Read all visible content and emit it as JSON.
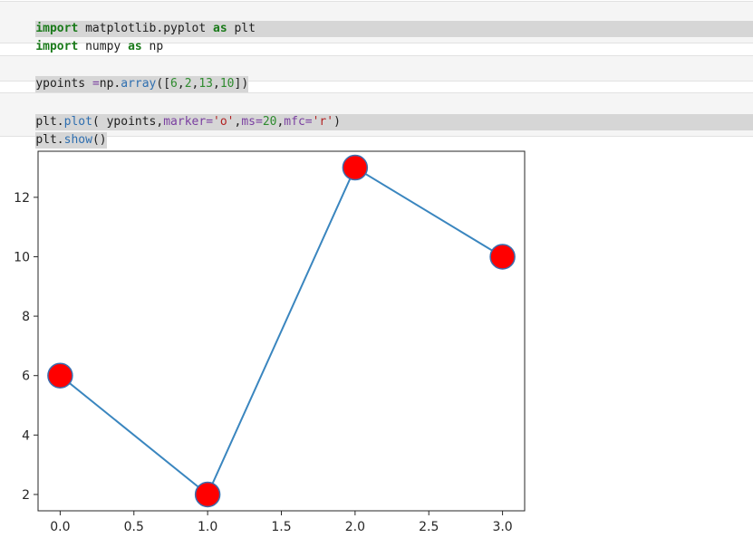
{
  "notebook": {
    "cells": [
      {
        "lines": [
          {
            "tokens": [
              {
                "text": "import",
                "cls": "kw"
              },
              {
                "text": " matplotlib.pyplot ",
                "cls": ""
              },
              {
                "text": "as",
                "cls": "kw"
              },
              {
                "text": " plt",
                "cls": ""
              }
            ]
          },
          {
            "tokens": [
              {
                "text": "import",
                "cls": "kw"
              },
              {
                "text": " numpy ",
                "cls": ""
              },
              {
                "text": "as",
                "cls": "kw"
              },
              {
                "text": " np",
                "cls": ""
              }
            ]
          }
        ]
      },
      {
        "lines": [
          {
            "tokens": [
              {
                "text": "ypoints ",
                "cls": ""
              },
              {
                "text": "=",
                "cls": "op"
              },
              {
                "text": "np.",
                "cls": ""
              },
              {
                "text": "array",
                "cls": "fn"
              },
              {
                "text": "([",
                "cls": ""
              },
              {
                "text": "6",
                "cls": "num"
              },
              {
                "text": ",",
                "cls": ""
              },
              {
                "text": "2",
                "cls": "num"
              },
              {
                "text": ",",
                "cls": ""
              },
              {
                "text": "13",
                "cls": "num"
              },
              {
                "text": ",",
                "cls": ""
              },
              {
                "text": "10",
                "cls": "num"
              },
              {
                "text": "])",
                "cls": ""
              }
            ]
          }
        ]
      },
      {
        "lines": [
          {
            "tokens": [
              {
                "text": "plt.",
                "cls": ""
              },
              {
                "text": "plot",
                "cls": "fn"
              },
              {
                "text": "( ypoints,",
                "cls": ""
              },
              {
                "text": "marker",
                "cls": "param"
              },
              {
                "text": "=",
                "cls": "op"
              },
              {
                "text": "'o'",
                "cls": "str"
              },
              {
                "text": ",",
                "cls": ""
              },
              {
                "text": "ms",
                "cls": "param"
              },
              {
                "text": "=",
                "cls": "op"
              },
              {
                "text": "20",
                "cls": "num"
              },
              {
                "text": ",",
                "cls": ""
              },
              {
                "text": "mfc",
                "cls": "param"
              },
              {
                "text": "=",
                "cls": "op"
              },
              {
                "text": "'r'",
                "cls": "str"
              },
              {
                "text": ")",
                "cls": ""
              }
            ]
          },
          {
            "tokens": [
              {
                "text": "plt.",
                "cls": ""
              },
              {
                "text": "show",
                "cls": "fn"
              },
              {
                "text": "()",
                "cls": ""
              }
            ]
          }
        ]
      }
    ]
  },
  "colors": {
    "line": "#3a86bf",
    "marker_fill": "#ff0000",
    "marker_edge": "#3a6fb0",
    "cell_background": "#f5f5f5",
    "current_line_highlight": "#d6d6d6"
  },
  "chart_data": {
    "type": "line",
    "x": [
      0,
      1,
      2,
      3
    ],
    "y": [
      6,
      2,
      13,
      10
    ],
    "marker": "o",
    "marker_size": 20,
    "marker_face_color": "r",
    "xlim": [
      -0.15,
      3.15
    ],
    "ylim": [
      1.45,
      13.55
    ],
    "xticks": [
      0.0,
      0.5,
      1.0,
      1.5,
      2.0,
      2.5,
      3.0
    ],
    "xtick_labels": [
      "0.0",
      "0.5",
      "1.0",
      "1.5",
      "2.0",
      "2.5",
      "3.0"
    ],
    "yticks": [
      2,
      4,
      6,
      8,
      10,
      12
    ],
    "ytick_labels": [
      "2",
      "4",
      "6",
      "8",
      "10",
      "12"
    ],
    "grid": false,
    "title": "",
    "xlabel": "",
    "ylabel": ""
  }
}
